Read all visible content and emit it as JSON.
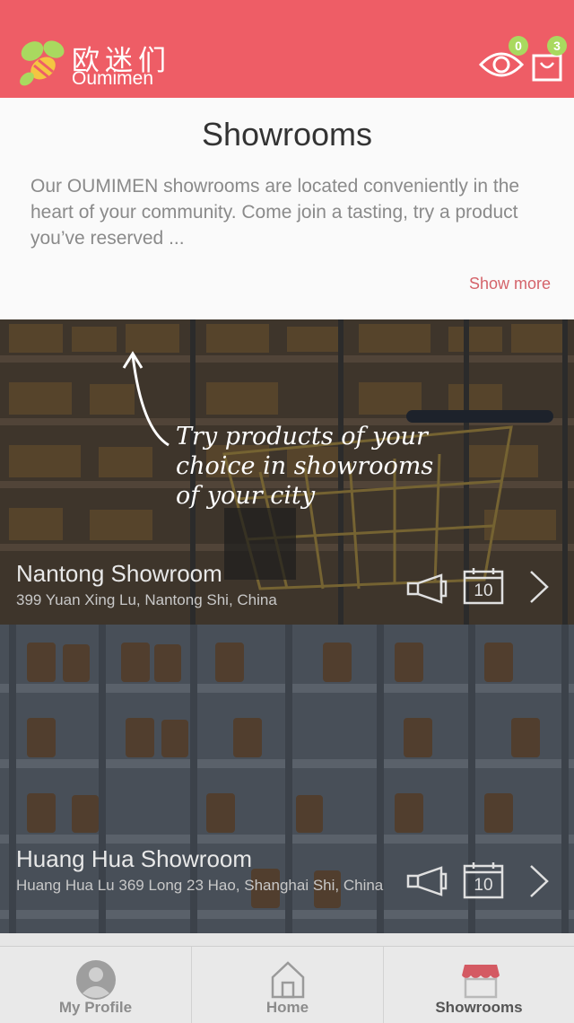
{
  "header": {
    "brand_cn": "欧迷们",
    "brand_en": "Oumimen",
    "viewed_count": "0",
    "cart_count": "3"
  },
  "intro": {
    "title": "Showrooms",
    "description": "Our OUMIMEN showrooms are located conveniently in the heart of your community. Come join a tasting, try a product you’ve reserved ...",
    "show_more": "Show more"
  },
  "annotation": {
    "line1": "Try products of your",
    "line2": "choice in showrooms",
    "line3": "of your city"
  },
  "showrooms": [
    {
      "name": "Nantong Showroom",
      "address": "399 Yuan Xing Lu, Nantong Shi, China",
      "calendar_day": "10"
    },
    {
      "name": "Huang Hua Showroom",
      "address": "Huang Hua Lu 369 Long 23 Hao, Shanghai Shi, China",
      "calendar_day": "10"
    }
  ],
  "tabs": [
    {
      "label": "My Profile",
      "icon": "profile-icon"
    },
    {
      "label": "Home",
      "icon": "home-icon"
    },
    {
      "label": "Showrooms",
      "icon": "store-icon",
      "active": true
    }
  ],
  "colors": {
    "brand": "#ee5d66",
    "badge": "#a9d95f",
    "link": "#d4636a"
  }
}
